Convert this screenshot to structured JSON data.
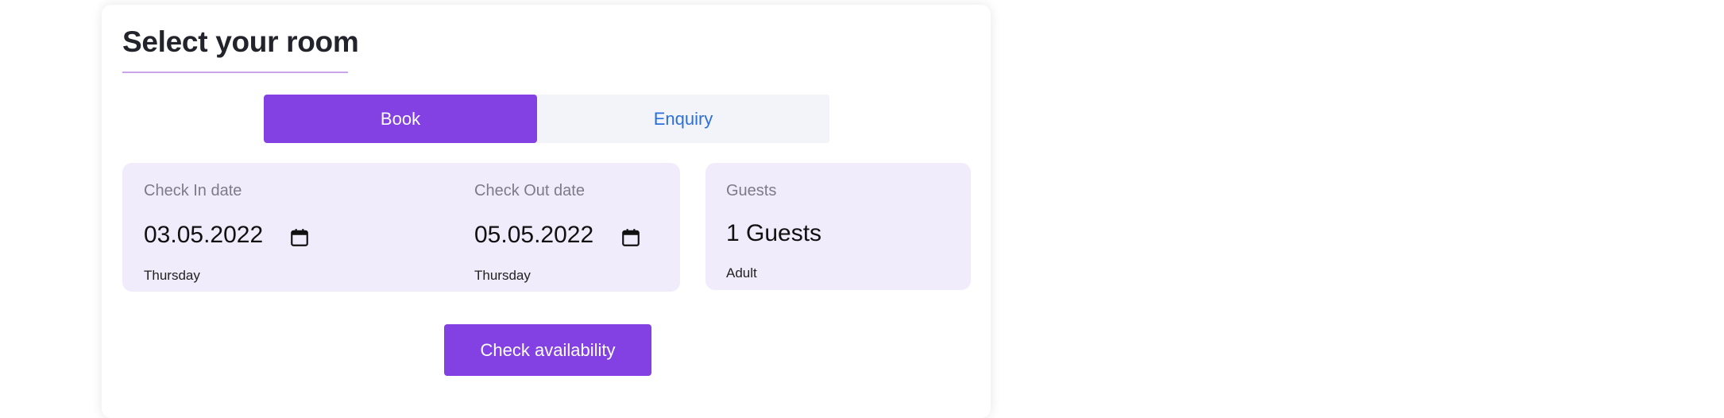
{
  "booking": {
    "title": "Select your room",
    "tabs": {
      "book": "Book",
      "enquiry": "Enquiry",
      "active": "Book"
    },
    "check_in": {
      "label": "Check In date",
      "value": "03.05.2022",
      "day": "Thursday"
    },
    "check_out": {
      "label": "Check Out date",
      "value": "05.05.2022",
      "day": "Thursday"
    },
    "guests": {
      "label": "Guests",
      "value": "1 Guests",
      "sub": "Adult"
    },
    "check_availability_label": "Check availability"
  },
  "icons": {
    "check_in_calendar": "calendar-icon",
    "check_out_calendar": "calendar-icon"
  },
  "colors": {
    "accent": "#8340e3",
    "panel_bg": "#f1ecfb",
    "tab_inactive_bg": "#f3f4f9",
    "tab_inactive_text": "#2c6fdc",
    "title_underline": "#c9a6ea"
  }
}
